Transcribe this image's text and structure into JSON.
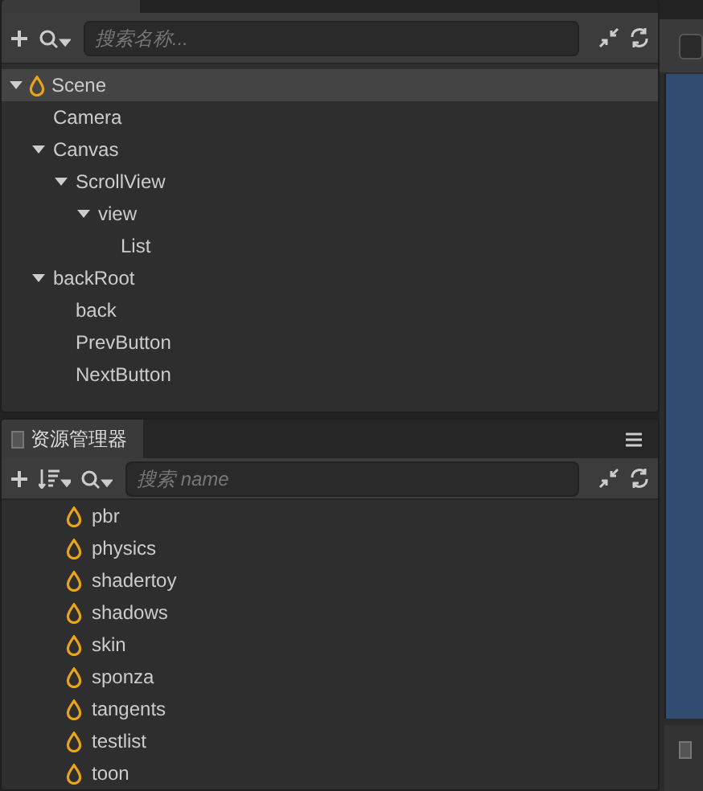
{
  "scene_view": {
    "checkbox": {
      "checked": false
    }
  },
  "hierarchy": {
    "search": {
      "placeholder": "搜索名称..."
    },
    "tree": [
      {
        "label": "Scene",
        "kind": "scene",
        "expanded": true,
        "selected": true,
        "children": [
          {
            "label": "Camera",
            "selected": false
          },
          {
            "label": "Canvas",
            "expanded": true,
            "selected": false,
            "children": [
              {
                "label": "ScrollView",
                "expanded": true,
                "selected": false,
                "children": [
                  {
                    "label": "view",
                    "expanded": true,
                    "selected": false,
                    "children": [
                      {
                        "label": "List",
                        "selected": false
                      }
                    ]
                  }
                ]
              }
            ]
          },
          {
            "label": "backRoot",
            "expanded": true,
            "selected": false,
            "children": [
              {
                "label": "back",
                "selected": false
              },
              {
                "label": "PrevButton",
                "selected": false
              },
              {
                "label": "NextButton",
                "selected": false
              }
            ]
          }
        ]
      }
    ]
  },
  "assets": {
    "title": "资源管理器",
    "search": {
      "placeholder": "搜索 name"
    },
    "items": [
      {
        "label": "pbr"
      },
      {
        "label": "physics"
      },
      {
        "label": "shadertoy"
      },
      {
        "label": "shadows"
      },
      {
        "label": "skin"
      },
      {
        "label": "sponza"
      },
      {
        "label": "tangents"
      },
      {
        "label": "testlist"
      },
      {
        "label": "toon"
      }
    ]
  }
}
